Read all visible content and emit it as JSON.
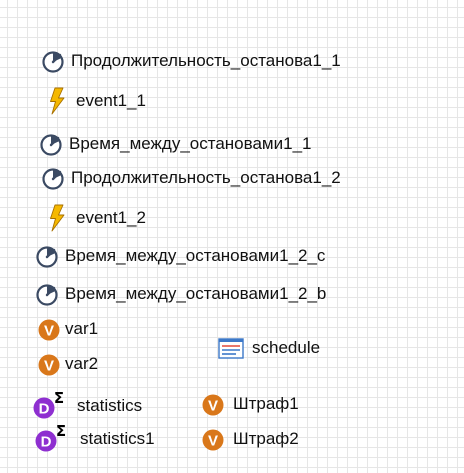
{
  "canvas": {
    "elements": [
      {
        "kind": "dynamic-event",
        "label": "Продолжительность_останова1_1"
      },
      {
        "kind": "event",
        "label": "event1_1"
      },
      {
        "kind": "dynamic-event",
        "label": "Время_между_остановами1_1"
      },
      {
        "kind": "dynamic-event",
        "label": "Продолжительность_останова1_2"
      },
      {
        "kind": "event",
        "label": "event1_2"
      },
      {
        "kind": "dynamic-event",
        "label": "Время_между_остановами1_2_c"
      },
      {
        "kind": "dynamic-event",
        "label": "Время_между_остановами1_2_b"
      },
      {
        "kind": "variable",
        "label": "var1"
      },
      {
        "kind": "variable",
        "label": "var2"
      },
      {
        "kind": "schedule",
        "label": "schedule"
      },
      {
        "kind": "statistics",
        "label": "statistics"
      },
      {
        "kind": "statistics",
        "label": "statistics1"
      },
      {
        "kind": "variable",
        "label": "Штраф1"
      },
      {
        "kind": "variable",
        "label": "Штраф2"
      }
    ]
  },
  "icons": {
    "dynamic-event": "dynamic-event-icon",
    "event": "event-lightning-icon",
    "variable": "variable-v-icon",
    "schedule": "schedule-icon",
    "statistics": "statistics-sigma-icon"
  },
  "colors": {
    "grid": "#e6e6e6",
    "event": "#f5b800",
    "variable": "#d9771a",
    "statistics": "#8e2fd0",
    "dynamic_event": "#3b4a63",
    "schedule": "#3c78c8"
  }
}
